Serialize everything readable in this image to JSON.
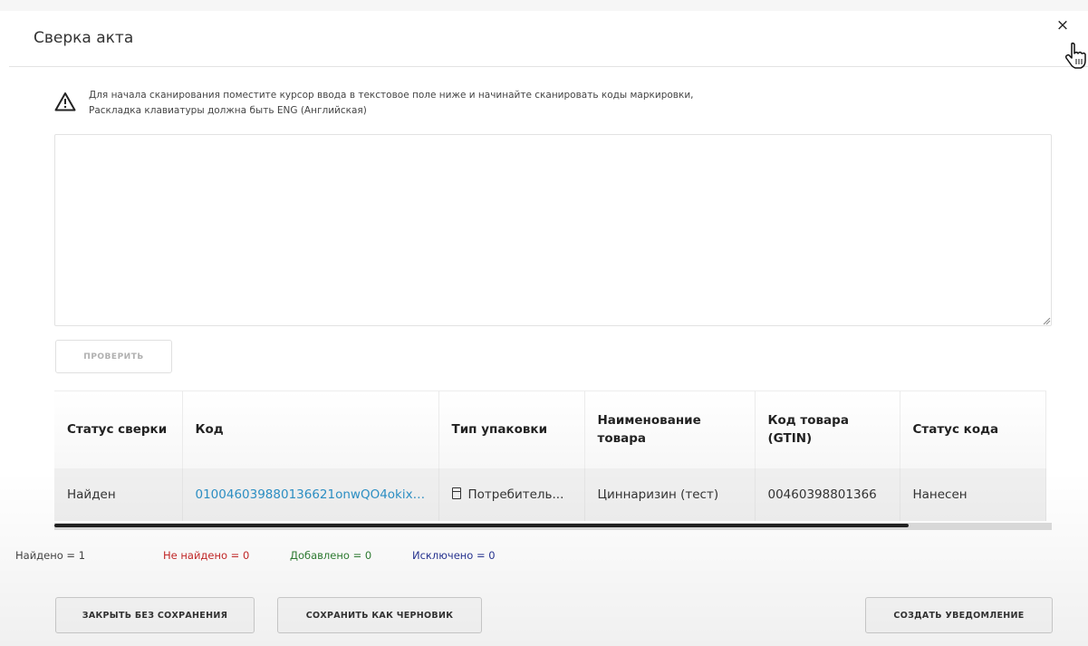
{
  "modal": {
    "title": "Сверка акта",
    "close_glyph": "×"
  },
  "warning": {
    "icon": "warning-triangle-icon",
    "line1": "Для начала сканирования поместите курсор ввода в текстовое поле ниже и начинайте сканировать коды маркировки,",
    "line2": "Раскладка клавиатуры должна быть ENG (Английская)"
  },
  "scan_input": {
    "value": "",
    "placeholder": ""
  },
  "check_button": "ПРОВЕРИТЬ",
  "table": {
    "columns": [
      "Статус сверки",
      "Код",
      "Тип упаковки",
      "Наименование товара",
      "Код товара (GTIN)",
      "Статус кода"
    ],
    "rows": [
      {
        "status": "Найден",
        "code": "010046039880136621onwQO4okixl...",
        "package_icon": "package-icon",
        "package": "Потребитель...",
        "name": "Циннаризин (тест)",
        "gtin": "00460398801366",
        "code_status": "Нанесен"
      }
    ]
  },
  "stats": {
    "found": "Найдено = 1",
    "not_found": "Не найдено = 0",
    "added": "Добавлено = 0",
    "excluded": "Исключено = 0"
  },
  "colors": {
    "link": "#2c8fc4",
    "not_found": "#c62828",
    "added": "#2e7d32",
    "excluded": "#283593"
  },
  "footer": {
    "close_without_save": "ЗАКРЫТЬ БЕЗ СОХРАНЕНИЯ",
    "save_draft": "СОХРАНИТЬ КАК ЧЕРНОВИК",
    "create_notification": "СОЗДАТЬ УВЕДОМЛЕНИЕ"
  }
}
